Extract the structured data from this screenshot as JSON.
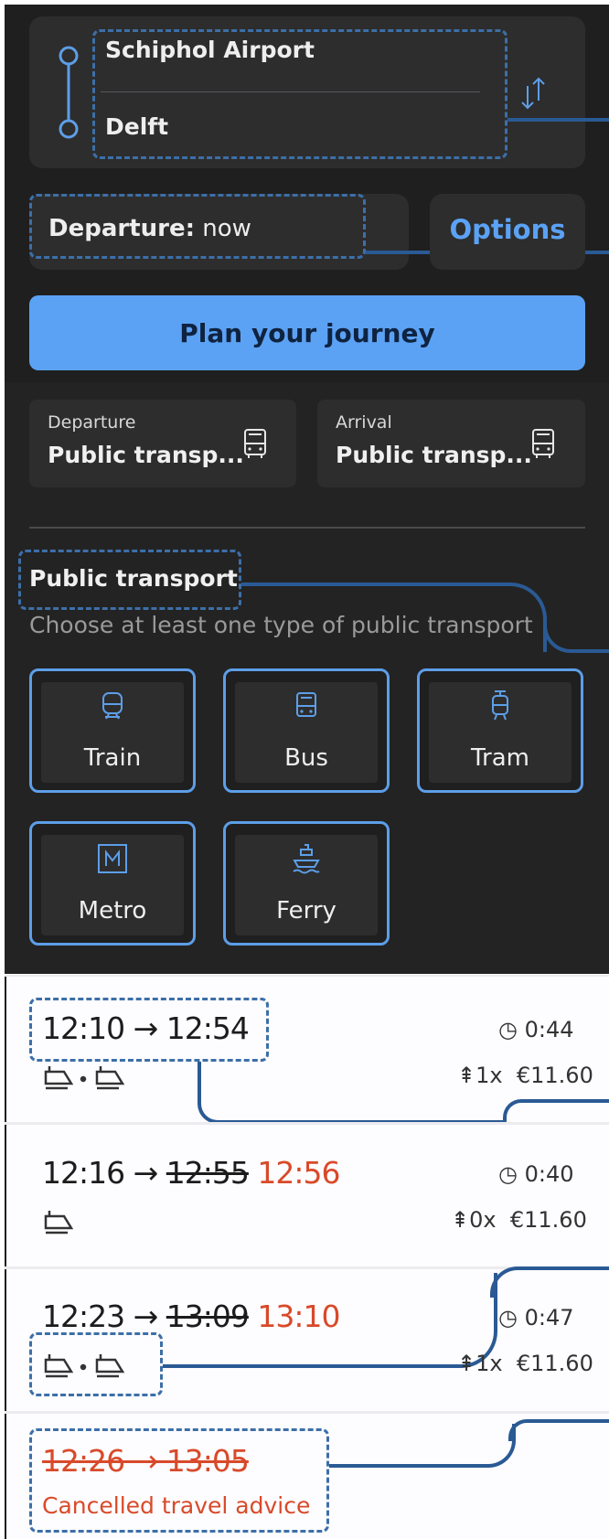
{
  "route": {
    "from": "Schiphol Airport",
    "to": "Delft",
    "swap_icon": "swap-vertical-icon"
  },
  "departure": {
    "label": "Departure:",
    "value": "now"
  },
  "options_label": "Options",
  "plan_button": "Plan your journey",
  "transport_cards": [
    {
      "label": "Departure",
      "value": "Public transp...",
      "icon": "bus-icon"
    },
    {
      "label": "Arrival",
      "value": "Public transp...",
      "icon": "bus-icon"
    }
  ],
  "public_transport": {
    "title": "Public transport",
    "subtitle": "Choose at least one type of public transport",
    "modes": [
      {
        "label": "Train",
        "icon": "train-icon"
      },
      {
        "label": "Bus",
        "icon": "bus-icon"
      },
      {
        "label": "Tram",
        "icon": "tram-icon"
      },
      {
        "label": "Metro",
        "icon": "metro-icon"
      },
      {
        "label": "Ferry",
        "icon": "ferry-icon"
      }
    ]
  },
  "journeys": [
    {
      "dep": "12:10",
      "arrow": "→",
      "arr": "12:54",
      "arr_new": "",
      "duration": "0:44",
      "transfers": "1x",
      "price": "€11.60",
      "legs": 2
    },
    {
      "dep": "12:16",
      "arrow": "→",
      "arr": "12:55",
      "arr_new": "12:56",
      "duration": "0:40",
      "transfers": "0x",
      "price": "€11.60",
      "legs": 1
    },
    {
      "dep": "12:23",
      "arrow": "→",
      "arr": "13:09",
      "arr_new": "13:10",
      "duration": "0:47",
      "transfers": "1x",
      "price": "€11.60",
      "legs": 2
    },
    {
      "times": "12:26 → 13:05",
      "status": "Cancelled travel advice"
    }
  ],
  "colors": {
    "accent": "#5ba2f5",
    "late": "#d84a2a",
    "annotation": "#2a5a94",
    "dark_bg": "#1f1f1f"
  }
}
